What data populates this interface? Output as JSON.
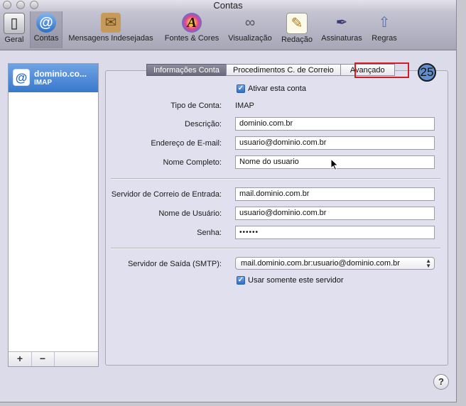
{
  "window": {
    "title": "Contas"
  },
  "toolbar": {
    "items": [
      {
        "label": "Geral",
        "icon": "general-switch-icon"
      },
      {
        "label": "Contas",
        "icon": "at-sign-icon",
        "selected": true
      },
      {
        "label": "Mensagens Indesejadas",
        "icon": "junk-mail-icon"
      },
      {
        "label": "Fontes & Cores",
        "icon": "fonts-colors-icon"
      },
      {
        "label": "Visualização",
        "icon": "viewing-glasses-icon"
      },
      {
        "label": "Redação",
        "icon": "composing-icon"
      },
      {
        "label": "Assinaturas",
        "icon": "signature-pen-icon"
      },
      {
        "label": "Regras",
        "icon": "rules-icon"
      }
    ]
  },
  "sidebar": {
    "accounts": [
      {
        "name": "dominio.co...",
        "type": "IMAP"
      }
    ],
    "add_label": "+",
    "remove_label": "−"
  },
  "tabs": [
    {
      "label": "Informações Conta",
      "active": true
    },
    {
      "label": "Procedimentos C. de Correio",
      "active": false
    },
    {
      "label": "Avançado",
      "active": false
    }
  ],
  "annotation": {
    "step": "25",
    "color": "#d21d26"
  },
  "form": {
    "enable_account": {
      "label": "Ativar esta conta",
      "checked": true
    },
    "account_type": {
      "label": "Tipo de Conta:",
      "value": "IMAP"
    },
    "description": {
      "label": "Descrição:",
      "value": "dominio.com.br"
    },
    "email": {
      "label": "Endereço de E-mail:",
      "value": "usuario@dominio.com.br"
    },
    "full_name": {
      "label": "Nome Completo:",
      "value": "Nome do usuario"
    },
    "incoming_server": {
      "label": "Servidor de Correio de Entrada:",
      "value": "mail.dominio.com.br"
    },
    "username": {
      "label": "Nome de Usuário:",
      "value": "usuario@dominio.com.br"
    },
    "password": {
      "label": "Senha:",
      "value": "••••••"
    },
    "smtp": {
      "label": "Servidor de Saída (SMTP):",
      "value": "mail.dominio.com.br:usuario@dominio.com.br"
    },
    "use_only_server": {
      "label": "Usar somente este servidor",
      "checked": true
    }
  },
  "help_label": "?"
}
